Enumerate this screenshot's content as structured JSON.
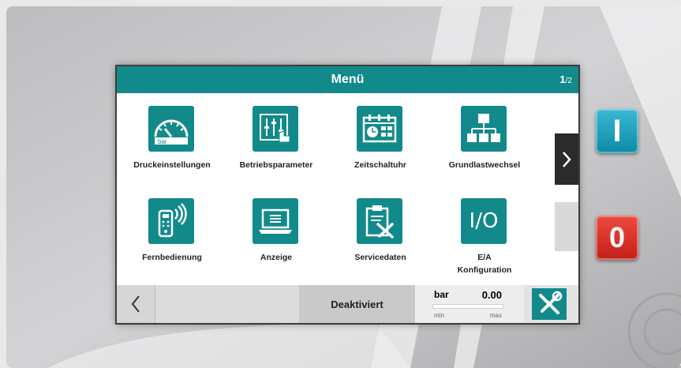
{
  "header": {
    "title": "Menü",
    "page_current": "1",
    "page_total": "/2"
  },
  "menu": {
    "items": [
      {
        "label": "Druckeinstellungen",
        "icon": "gauge-icon",
        "icon_text": "bar"
      },
      {
        "label": "Betriebsparameter",
        "icon": "sliders-icon"
      },
      {
        "label": "Zeitschaltuhr",
        "icon": "calendar-clock-icon"
      },
      {
        "label": "Grundlastwechsel",
        "icon": "hierarchy-icon"
      },
      {
        "label": "Fernbedienung",
        "icon": "remote-control-icon"
      },
      {
        "label": "Anzeige",
        "icon": "laptop-icon"
      },
      {
        "label": "Servicedaten",
        "icon": "clipboard-tools-icon"
      },
      {
        "label": "E/A\nKonfiguration",
        "icon": "io-icon",
        "icon_text": "I/O"
      }
    ]
  },
  "nav": {
    "next_icon": "chevron-right-icon",
    "back_icon": "chevron-left-icon"
  },
  "status": {
    "state": "Deaktiviert",
    "unit": "bar",
    "value": "0.00",
    "min_label": "min",
    "max_label": "max",
    "tools_icon": "tools-icon"
  },
  "hardware": {
    "on_label": "I",
    "off_label": "0",
    "on_color": "#1aa3c0",
    "off_color": "#d9302a"
  },
  "colors": {
    "accent": "#128a8b"
  }
}
